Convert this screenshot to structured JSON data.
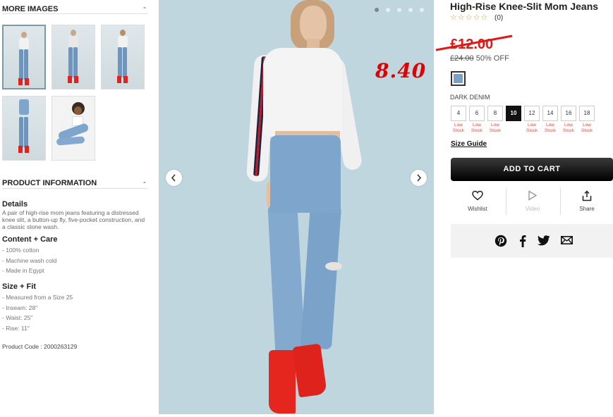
{
  "more_images": {
    "title": "MORE IMAGES",
    "toggle": "-"
  },
  "product_info": {
    "title": "PRODUCT INFORMATION",
    "toggle": "-",
    "details_heading": "Details",
    "details_text": "A pair of high-rise mom jeans featuring a distressed knee slit, a button-up fly, five-pocket construction, and a classic stone wash.",
    "content_heading": "Content + Care",
    "content_items": [
      "- 100% cotton",
      "- Machine wash cold",
      "- Made in Egypt"
    ],
    "size_heading": "Size + Fit",
    "size_items": [
      "- Measured from a Size 25",
      "- Inseam: 28\"",
      "- Waist: 25\"",
      "- Rise: 11\""
    ],
    "product_code": "Product Code : 2000263129"
  },
  "main_image": {
    "overlay_price": "8.40"
  },
  "product": {
    "title": "High-Rise Knee-Slit Mom Jeans",
    "stars": "☆☆☆☆☆",
    "rating_count": "(0)",
    "old_price": "£12.00",
    "was_price": "£24.00",
    "discount": "50% OFF",
    "color_name": "DARK DENIM",
    "sizes": [
      "4",
      "6",
      "8",
      "10",
      "12",
      "14",
      "16",
      "18"
    ],
    "selected_size": "10",
    "low_stock_line1": "Low",
    "low_stock_line2": "Stock",
    "size_guide": "Size Guide",
    "add_to_cart": "ADD TO CART",
    "actions": {
      "wishlist": "Wishlist",
      "video": "Video",
      "share": "Share"
    }
  },
  "colors": {
    "accent_red": "#e01818",
    "denim": "#7a9fc8",
    "button_dark": "#111111"
  }
}
